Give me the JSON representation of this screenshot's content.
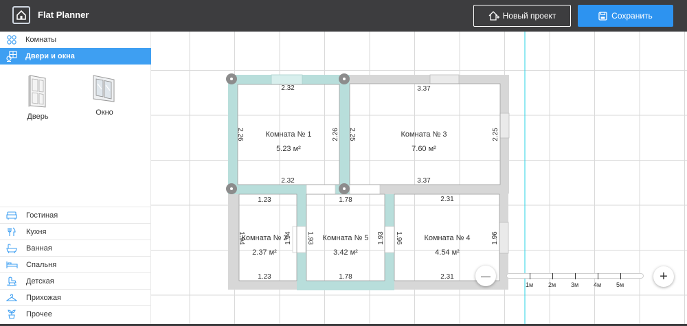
{
  "app": {
    "title": "Flat Planner"
  },
  "header": {
    "new_project_label": "Новый проект",
    "save_label": "Сохранить"
  },
  "sidebar": {
    "rooms_label": "Комнаты",
    "doors_windows_label": "Двери и окна",
    "catalog": [
      {
        "label": "Дверь",
        "icon": "door-icon"
      },
      {
        "label": "Окно",
        "icon": "window-icon"
      }
    ],
    "categories": [
      {
        "label": "Гостиная",
        "icon": "sofa-icon"
      },
      {
        "label": "Кухня",
        "icon": "cutlery-icon"
      },
      {
        "label": "Ванная",
        "icon": "bathtub-icon"
      },
      {
        "label": "Спальня",
        "icon": "bed-icon"
      },
      {
        "label": "Детская",
        "icon": "rocking-horse-icon"
      },
      {
        "label": "Прихожая",
        "icon": "hanger-icon"
      },
      {
        "label": "Прочее",
        "icon": "plant-icon"
      }
    ]
  },
  "plan": {
    "rooms": [
      {
        "name": "Комната №  1",
        "area": "5.23 м²",
        "dims": [
          "2.32",
          "2.32",
          "2.26",
          "2.26"
        ]
      },
      {
        "name": "Комната №  3",
        "area": "7.60 м²",
        "dims": [
          "3.37",
          "3.37",
          "2.25",
          "2.25"
        ]
      },
      {
        "name": "Комната №  2",
        "area": "2.37 м²",
        "dims": [
          "1.23",
          "1.23",
          "1.94",
          "1.94"
        ]
      },
      {
        "name": "Комната №  5",
        "area": "3.42 м²",
        "dims": [
          "1.78",
          "1.78",
          "1.93",
          "1.93"
        ]
      },
      {
        "name": "Комната №  4",
        "area": "4.54 м²",
        "dims": [
          "2.31",
          "2.31",
          "1.96",
          "1.96"
        ]
      }
    ]
  },
  "scale": {
    "labels": [
      "1м",
      "2м",
      "3м",
      "4м",
      "5м"
    ]
  },
  "zoom": {
    "out_label": "—",
    "in_label": "+"
  },
  "colors": {
    "accent": "#3e9ff2",
    "save": "#2d93f0",
    "topbar": "#3d3d3f",
    "selected_wall": "#b8dedb"
  }
}
